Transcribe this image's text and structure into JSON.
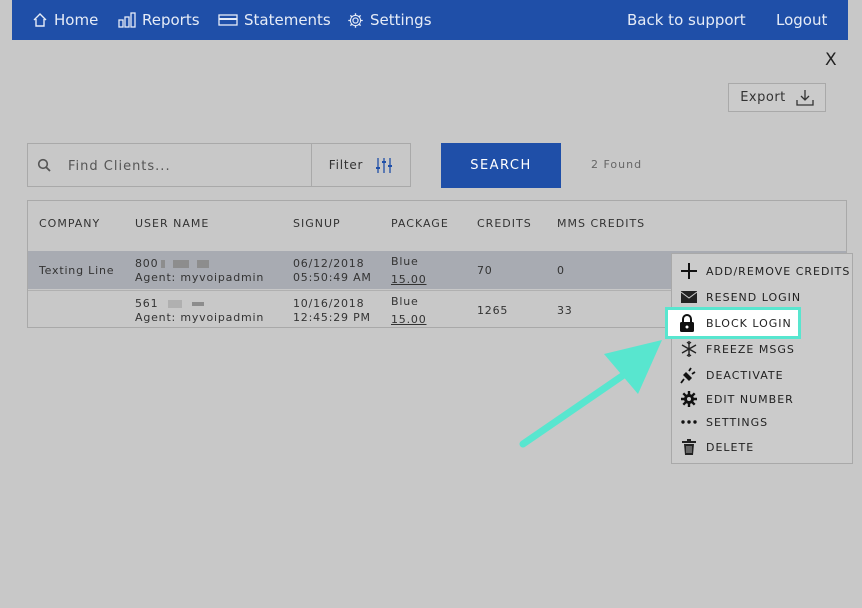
{
  "nav": {
    "home": "Home",
    "reports": "Reports",
    "statements": "Statements",
    "settings": "Settings",
    "back_to_support": "Back to support",
    "logout": "Logout"
  },
  "close_label": "X",
  "export_label": "Export",
  "search": {
    "placeholder": "Find Clients...",
    "filter_label": "Filter",
    "button_label": "SEARCH",
    "found_text": "2 Found"
  },
  "table": {
    "headers": [
      "COMPANY",
      "USER NAME",
      "SIGNUP",
      "PACKAGE",
      "CREDITS",
      "MMS CREDITS"
    ],
    "rows": [
      {
        "company": "Texting Line",
        "user_prefix": "800",
        "agent": "Agent: myvoipadmin",
        "signup_date": "06/12/2018",
        "signup_time": "05:50:49 AM",
        "package": "Blue",
        "price": "15.00",
        "credits": "70",
        "mms_credits": "0"
      },
      {
        "company": "",
        "user_prefix": "561",
        "agent": "Agent: myvoipadmin",
        "signup_date": "10/16/2018",
        "signup_time": "12:45:29 PM",
        "package": "Blue",
        "price": "15.00",
        "credits": "1265",
        "mms_credits": "33"
      }
    ]
  },
  "menu": [
    {
      "label": "ADD/REMOVE CREDITS",
      "icon": "plus-icon"
    },
    {
      "label": "RESEND LOGIN",
      "icon": "envelope-icon"
    },
    {
      "label": "BLOCK LOGIN",
      "icon": "lock-icon",
      "highlighted": true
    },
    {
      "label": "FREEZE MSGS",
      "icon": "snowflake-icon"
    },
    {
      "label": "DEACTIVATE",
      "icon": "plug-icon"
    },
    {
      "label": "EDIT NUMBER",
      "icon": "gear-icon"
    },
    {
      "label": "SETTINGS",
      "icon": "ellipsis-icon"
    },
    {
      "label": "DELETE",
      "icon": "trash-icon"
    }
  ],
  "colors": {
    "nav_bg": "#1f4fa8",
    "accent_highlight": "#58e6cf",
    "selected_row": "#a8abb2"
  }
}
